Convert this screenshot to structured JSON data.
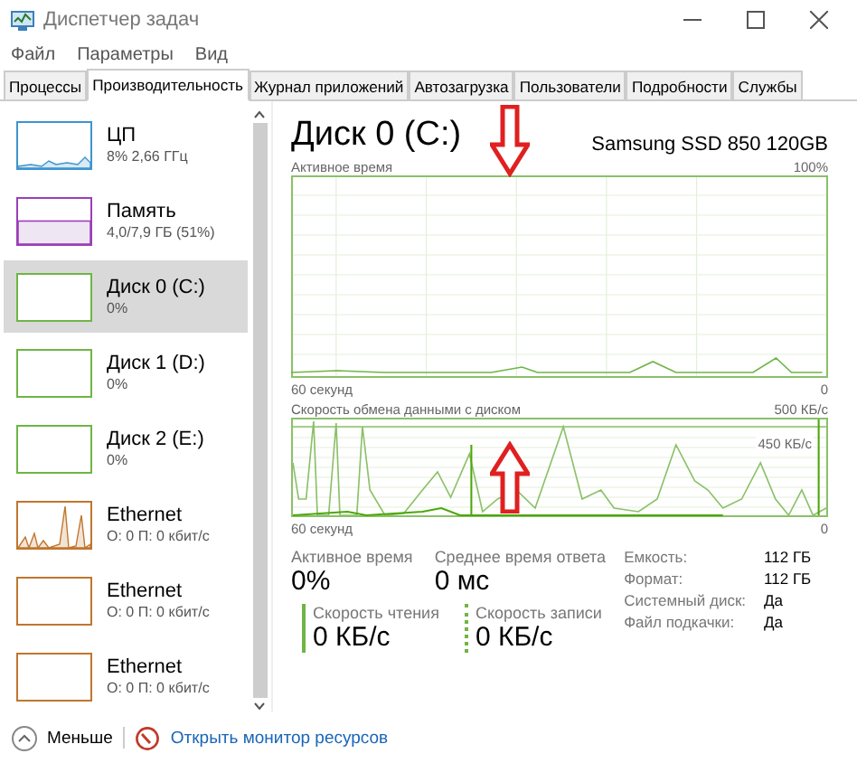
{
  "window": {
    "title": "Диспетчер задач"
  },
  "menu": [
    "Файл",
    "Параметры",
    "Вид"
  ],
  "tabs": [
    {
      "label": "Процессы",
      "selected": false
    },
    {
      "label": "Производительность",
      "selected": true
    },
    {
      "label": "Журнал приложений",
      "selected": false
    },
    {
      "label": "Автозагрузка",
      "selected": false
    },
    {
      "label": "Пользователи",
      "selected": false
    },
    {
      "label": "Подробности",
      "selected": false
    },
    {
      "label": "Службы",
      "selected": false
    }
  ],
  "sidebar": {
    "items": [
      {
        "kind": "cpu",
        "name": "ЦП",
        "detail": "8% 2,66 ГГц",
        "color": "#3d94cf",
        "busy": true,
        "selected": false
      },
      {
        "kind": "memory",
        "name": "Память",
        "detail": "4,0/7,9 ГБ (51%)",
        "color": "#9b3fb8",
        "level": 0.51,
        "busy": false,
        "selected": false
      },
      {
        "kind": "disk",
        "name": "Диск 0 (C:)",
        "detail": "0%",
        "color": "#6fb545",
        "busy": false,
        "selected": true
      },
      {
        "kind": "disk",
        "name": "Диск 1 (D:)",
        "detail": "0%",
        "color": "#6fb545",
        "busy": false,
        "selected": false
      },
      {
        "kind": "disk",
        "name": "Диск 2 (E:)",
        "detail": "0%",
        "color": "#6fb545",
        "busy": false,
        "selected": false
      },
      {
        "kind": "ethernet",
        "name": "Ethernet",
        "detail": "О: 0 П: 0 кбит/с",
        "color": "#c0762e",
        "busy": true,
        "selected": false
      },
      {
        "kind": "ethernet",
        "name": "Ethernet",
        "detail": "О: 0 П: 0 кбит/с",
        "color": "#c0762e",
        "busy": false,
        "selected": false
      },
      {
        "kind": "ethernet",
        "name": "Ethernet",
        "detail": "О: 0 П: 0 кбит/с",
        "color": "#c0762e",
        "busy": false,
        "selected": false
      }
    ]
  },
  "disk": {
    "title": "Диск 0 (C:)",
    "model": "Samsung SSD 850 120GB",
    "active_graph": {
      "label": "Активное время",
      "max": "100%",
      "span": "60 секунд",
      "min": "0"
    },
    "transfer_graph": {
      "label": "Скорость обмена данными с диском",
      "max": "500 КБ/с",
      "mark": "450 КБ/с",
      "span": "60 секунд",
      "min": "0"
    },
    "stats": [
      {
        "label": "Активное время",
        "value": "0%"
      },
      {
        "label": "Среднее время ответа",
        "value": "0 мс"
      }
    ],
    "rates": [
      {
        "kind": "read",
        "label": "Скорость чтения",
        "value": "0 КБ/с"
      },
      {
        "kind": "write",
        "label": "Скорость записи",
        "value": "0 КБ/с"
      }
    ],
    "properties": [
      {
        "label": "Емкость:",
        "value": "112 ГБ"
      },
      {
        "label": "Формат:",
        "value": "112 ГБ"
      },
      {
        "label": "Системный диск:",
        "value": "Да"
      },
      {
        "label": "Файл подкачки:",
        "value": "Да"
      }
    ]
  },
  "footer": {
    "less": "Меньше",
    "link": "Открыть монитор ресурсов"
  }
}
